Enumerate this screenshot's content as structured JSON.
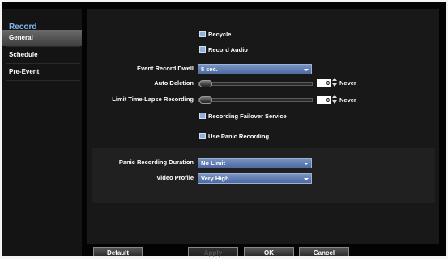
{
  "sidebar": {
    "title": "Record",
    "items": [
      {
        "label": "General",
        "selected": true
      },
      {
        "label": "Schedule",
        "selected": false
      },
      {
        "label": "Pre-Event",
        "selected": false
      }
    ]
  },
  "options": {
    "recycle": "Recycle",
    "record_audio": "Record Audio",
    "recording_failover": "Recording Failover Service",
    "use_panic": "Use Panic Recording"
  },
  "fields": {
    "event_record_dwell_label": "Event Record Dwell",
    "event_record_dwell_value": "5 sec.",
    "auto_deletion_label": "Auto Deletion",
    "auto_deletion_value": "0",
    "auto_deletion_unit": "Never",
    "limit_timelapse_label": "Limit Time-Lapse Recording",
    "limit_timelapse_value": "0",
    "limit_timelapse_unit": "Never",
    "panic_duration_label": "Panic Recording Duration",
    "panic_duration_value": "No Limit",
    "video_profile_label": "Video Profile",
    "video_profile_value": "Very High"
  },
  "buttons": {
    "default": "Default",
    "apply": "Apply",
    "ok": "OK",
    "cancel": "Cancel"
  },
  "colors": {
    "accent": "#7fb6ee",
    "dropdown": "#5b78ad"
  }
}
